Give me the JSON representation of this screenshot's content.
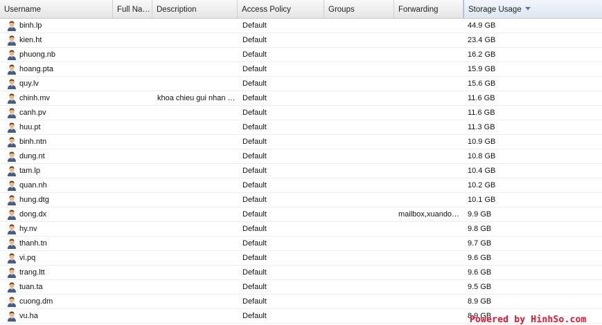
{
  "columns": [
    {
      "key": "username",
      "label": "Username"
    },
    {
      "key": "fullname",
      "label": "Full Na…"
    },
    {
      "key": "description",
      "label": "Description"
    },
    {
      "key": "policy",
      "label": "Access Policy"
    },
    {
      "key": "groups",
      "label": "Groups"
    },
    {
      "key": "forwarding",
      "label": "Forwarding"
    },
    {
      "key": "storage",
      "label": "Storage Usage"
    }
  ],
  "rows": [
    {
      "username": "binh.lp",
      "fullname": "",
      "description": "",
      "policy": "Default",
      "groups": "",
      "forwarding": "",
      "storage": "44.9 GB"
    },
    {
      "username": "kien.ht",
      "fullname": "",
      "description": "",
      "policy": "Default",
      "groups": "",
      "forwarding": "",
      "storage": "23.4 GB"
    },
    {
      "username": "phuong.nb",
      "fullname": "",
      "description": "",
      "policy": "Default",
      "groups": "",
      "forwarding": "",
      "storage": "16.2 GB"
    },
    {
      "username": "hoang.pta",
      "fullname": "",
      "description": "",
      "policy": "Default",
      "groups": "",
      "forwarding": "",
      "storage": "15.9 GB"
    },
    {
      "username": "quy.lv",
      "fullname": "",
      "description": "",
      "policy": "Default",
      "groups": "",
      "forwarding": "",
      "storage": "15.6 GB"
    },
    {
      "username": "chinh.mv",
      "fullname": "",
      "description": "khoa chieu gui nhan …",
      "policy": "Default",
      "groups": "",
      "forwarding": "",
      "storage": "11.6 GB"
    },
    {
      "username": "canh.pv",
      "fullname": "",
      "description": "",
      "policy": "Default",
      "groups": "",
      "forwarding": "",
      "storage": "11.6 GB"
    },
    {
      "username": "huu.pt",
      "fullname": "",
      "description": "",
      "policy": "Default",
      "groups": "",
      "forwarding": "",
      "storage": "11.3 GB"
    },
    {
      "username": "binh.ntn",
      "fullname": "",
      "description": "",
      "policy": "Default",
      "groups": "",
      "forwarding": "",
      "storage": "10.9 GB"
    },
    {
      "username": "dung.nt",
      "fullname": "",
      "description": "",
      "policy": "Default",
      "groups": "",
      "forwarding": "",
      "storage": "10.8 GB"
    },
    {
      "username": "tam.lp",
      "fullname": "",
      "description": "",
      "policy": "Default",
      "groups": "",
      "forwarding": "",
      "storage": "10.4 GB"
    },
    {
      "username": "quan.nh",
      "fullname": "",
      "description": "",
      "policy": "Default",
      "groups": "",
      "forwarding": "",
      "storage": "10.2 GB"
    },
    {
      "username": "hung.dtg",
      "fullname": "",
      "description": "",
      "policy": "Default",
      "groups": "",
      "forwarding": "",
      "storage": "10.1 GB"
    },
    {
      "username": "dong.dx",
      "fullname": "",
      "description": "",
      "policy": "Default",
      "groups": "",
      "forwarding": "mailbox,xuando…",
      "storage": "9.9 GB"
    },
    {
      "username": "hy.nv",
      "fullname": "",
      "description": "",
      "policy": "Default",
      "groups": "",
      "forwarding": "",
      "storage": "9.8 GB"
    },
    {
      "username": "thanh.tn",
      "fullname": "",
      "description": "",
      "policy": "Default",
      "groups": "",
      "forwarding": "",
      "storage": "9.7 GB"
    },
    {
      "username": "vi.pq",
      "fullname": "",
      "description": "",
      "policy": "Default",
      "groups": "",
      "forwarding": "",
      "storage": "9.6 GB"
    },
    {
      "username": "trang.ltt",
      "fullname": "",
      "description": "",
      "policy": "Default",
      "groups": "",
      "forwarding": "",
      "storage": "9.6 GB"
    },
    {
      "username": "tuan.ta",
      "fullname": "",
      "description": "",
      "policy": "Default",
      "groups": "",
      "forwarding": "",
      "storage": "9.5 GB"
    },
    {
      "username": "cuong.dm",
      "fullname": "",
      "description": "",
      "policy": "Default",
      "groups": "",
      "forwarding": "",
      "storage": "8.9 GB"
    },
    {
      "username": "vu.ha",
      "fullname": "",
      "description": "",
      "policy": "Default",
      "groups": "",
      "forwarding": "",
      "storage": "8.9 GB"
    }
  ],
  "sort": {
    "column": "storage",
    "direction": "descending",
    "icon": "sort-descending-icon"
  },
  "row_icon": "user-icon",
  "watermark": "Powered by HinhSo.com",
  "colors": {
    "watermark": "#e8132c",
    "sorted_header": "#dde6f1",
    "sort_arrow": "#5b7fa6"
  }
}
